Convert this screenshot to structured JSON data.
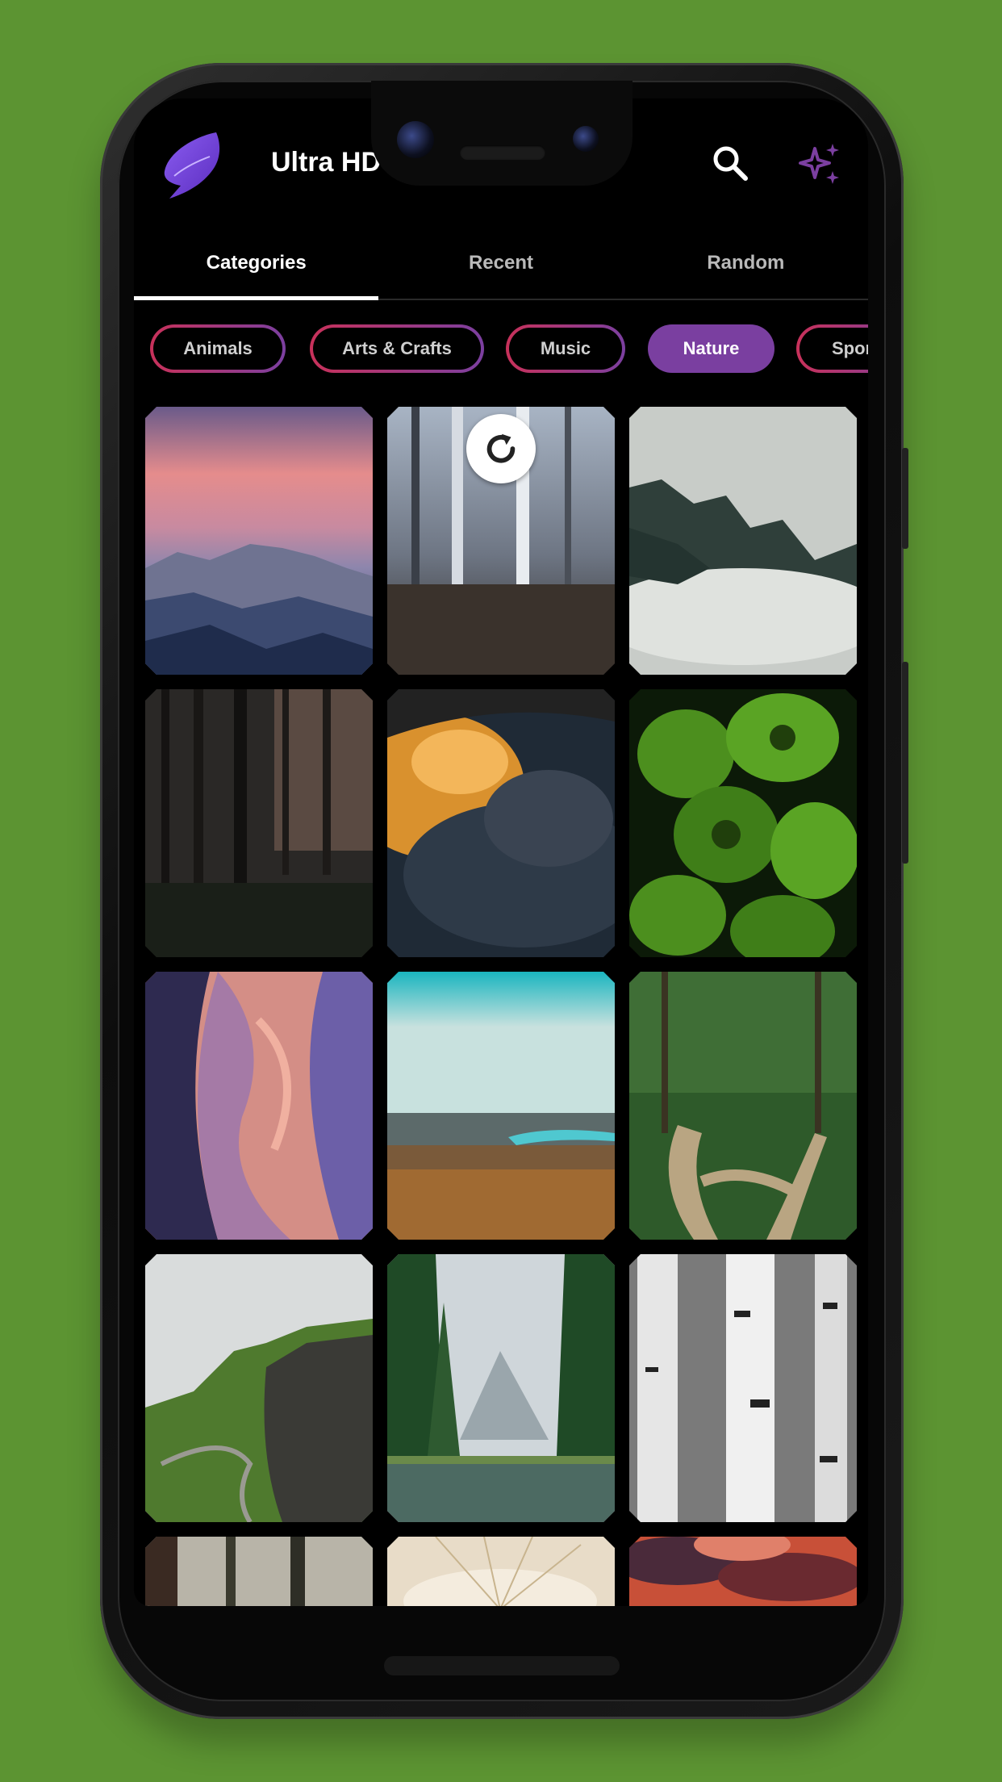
{
  "app": {
    "title": "Ultra HD",
    "logo_icon": "feather-logo-icon",
    "actions": [
      {
        "icon": "search-icon"
      },
      {
        "icon": "sparkle-icon",
        "color": "#7b3fa0"
      }
    ]
  },
  "tabs": [
    {
      "label": "Categories",
      "active": true
    },
    {
      "label": "Recent",
      "active": false
    },
    {
      "label": "Random",
      "active": false
    }
  ],
  "chips": [
    {
      "label": "Animals",
      "active": false
    },
    {
      "label": "Arts & Crafts",
      "active": false
    },
    {
      "label": "Music",
      "active": false
    },
    {
      "label": "Nature",
      "active": true
    },
    {
      "label": "Spor",
      "active": false
    }
  ],
  "loading_indicator": {
    "icon": "refresh-icon"
  },
  "wallpapers": [
    {
      "subject": "mountain-sunset"
    },
    {
      "subject": "misty-forest"
    },
    {
      "subject": "foggy-valley"
    },
    {
      "subject": "dark-forest"
    },
    {
      "subject": "sunset-clouds"
    },
    {
      "subject": "green-leaves"
    },
    {
      "subject": "canyon"
    },
    {
      "subject": "valley-river"
    },
    {
      "subject": "forest-path"
    },
    {
      "subject": "green-cliffs"
    },
    {
      "subject": "lake-pines"
    },
    {
      "subject": "birch-trees"
    },
    {
      "subject": "tree-trunks"
    },
    {
      "subject": "dandelion-seeds"
    },
    {
      "subject": "red-clouds"
    }
  ],
  "colors": {
    "accent": "#7a3fa0",
    "chip_border_start": "#c8315a",
    "chip_border_end": "#7b3fa0",
    "background": "#000000",
    "device_background": "#5c9432"
  }
}
